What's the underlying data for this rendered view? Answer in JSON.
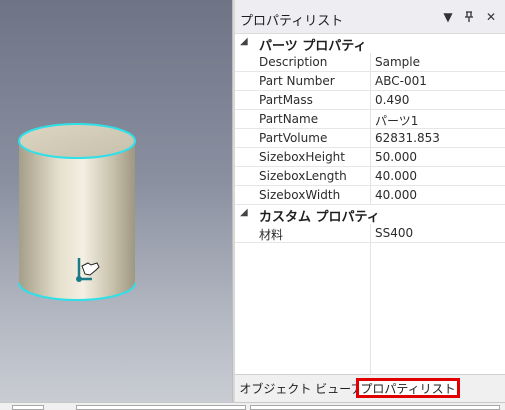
{
  "panel": {
    "title": "プロパティリスト",
    "buttons": {
      "dropdown": "▼",
      "pin": "ᛘ",
      "close": "✕"
    }
  },
  "categories": [
    {
      "label": "パーツ プロパティ",
      "rows": [
        {
          "name": "Description",
          "value": "Sample"
        },
        {
          "name": "Part Number",
          "value": "ABC-001"
        },
        {
          "name": "PartMass",
          "value": "0.490"
        },
        {
          "name": "PartName",
          "value": "パーツ1"
        },
        {
          "name": "PartVolume",
          "value": "62831.853"
        },
        {
          "name": "SizeboxHeight",
          "value": "50.000"
        },
        {
          "name": "SizeboxLength",
          "value": "40.000"
        },
        {
          "name": "SizeboxWidth",
          "value": "40.000"
        }
      ]
    },
    {
      "label": "カスタム プロパティ",
      "rows": [
        {
          "name": "材料",
          "value": "SS400"
        }
      ]
    }
  ],
  "tabs": [
    {
      "label": "オブジェクト ビューア",
      "active": false
    },
    {
      "label": "プロパティリスト",
      "active": true
    }
  ],
  "colors": {
    "highlight_edge": "#2fe0e8",
    "active_tab_border": "#e00000"
  }
}
